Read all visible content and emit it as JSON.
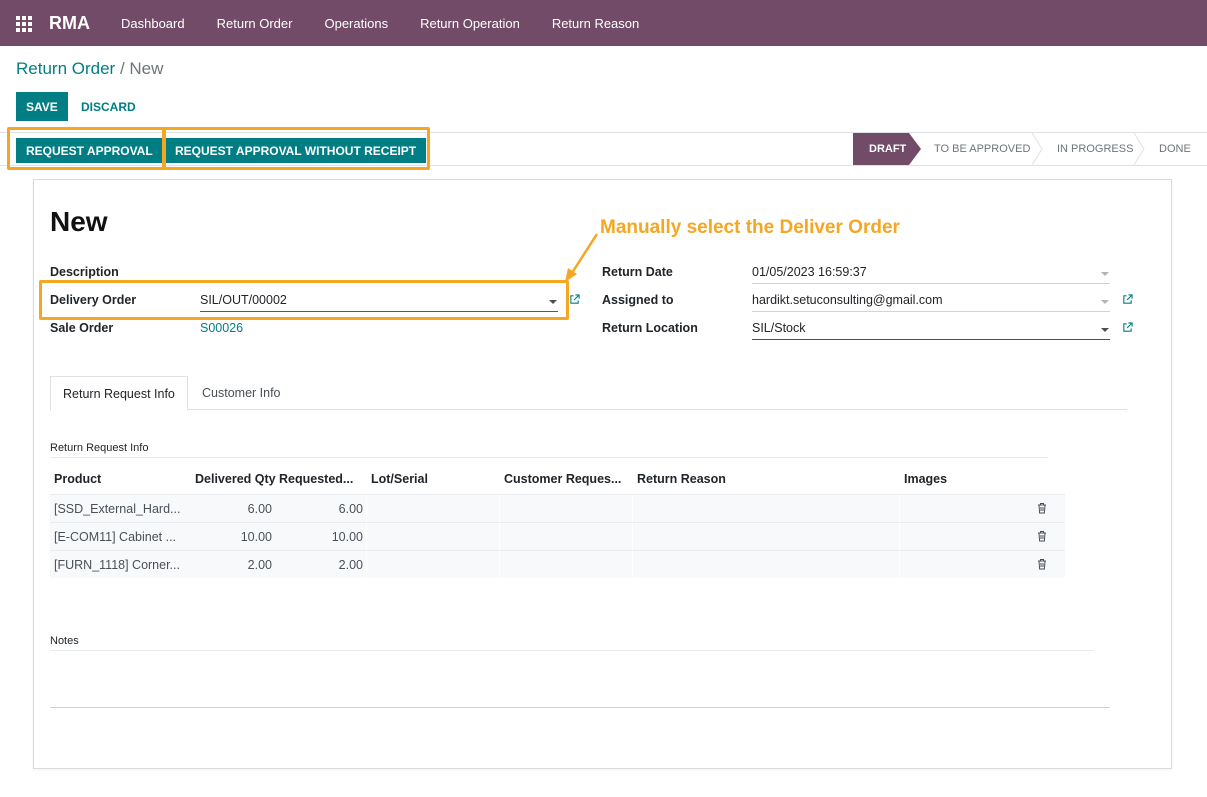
{
  "nav": {
    "brand": "RMA",
    "items": [
      "Dashboard",
      "Return Order",
      "Operations",
      "Return Operation",
      "Return Reason"
    ]
  },
  "breadcrumb": {
    "parent": "Return Order",
    "separator": "/",
    "current": "New"
  },
  "buttons": {
    "save": "SAVE",
    "discard": "DISCARD"
  },
  "header_actions": {
    "request_approval": "REQUEST APPROVAL",
    "request_approval_without_receipt": "REQUEST APPROVAL WITHOUT RECEIPT"
  },
  "stages": [
    "DRAFT",
    "TO BE APPROVED",
    "IN PROGRESS",
    "DONE"
  ],
  "form": {
    "title": "New",
    "annotation": "Manually select the Deliver Order",
    "description_label": "Description",
    "delivery_order_label": "Delivery Order",
    "delivery_order_value": "SIL/OUT/00002",
    "sale_order_label": "Sale Order",
    "sale_order_value": "S00026",
    "return_date_label": "Return Date",
    "return_date_value": "01/05/2023 16:59:37",
    "assigned_to_label": "Assigned to",
    "assigned_to_value": "hardikt.setuconsulting@gmail.com",
    "return_location_label": "Return Location",
    "return_location_value": "SIL/Stock"
  },
  "tabs": [
    "Return Request Info",
    "Customer Info"
  ],
  "section_title": "Return Request Info",
  "table": {
    "headers": [
      "Product",
      "Delivered Qty",
      "Requested...",
      "Lot/Serial",
      "Customer Reques...",
      "Return Reason",
      "Images"
    ],
    "rows": [
      {
        "product": "[SSD_External_Hard...",
        "delivered": "6.00",
        "requested": "6.00"
      },
      {
        "product": "[E-COM11] Cabinet ...",
        "delivered": "10.00",
        "requested": "10.00"
      },
      {
        "product": "[FURN_1118] Corner...",
        "delivered": "2.00",
        "requested": "2.00"
      }
    ]
  },
  "notes_label": "Notes",
  "colors": {
    "brand": "#714b67",
    "primary": "#017e84",
    "highlight": "#f5a623"
  },
  "icons": [
    "apps-grid-icon",
    "dropdown-caret-icon",
    "external-link-icon",
    "trash-icon"
  ]
}
